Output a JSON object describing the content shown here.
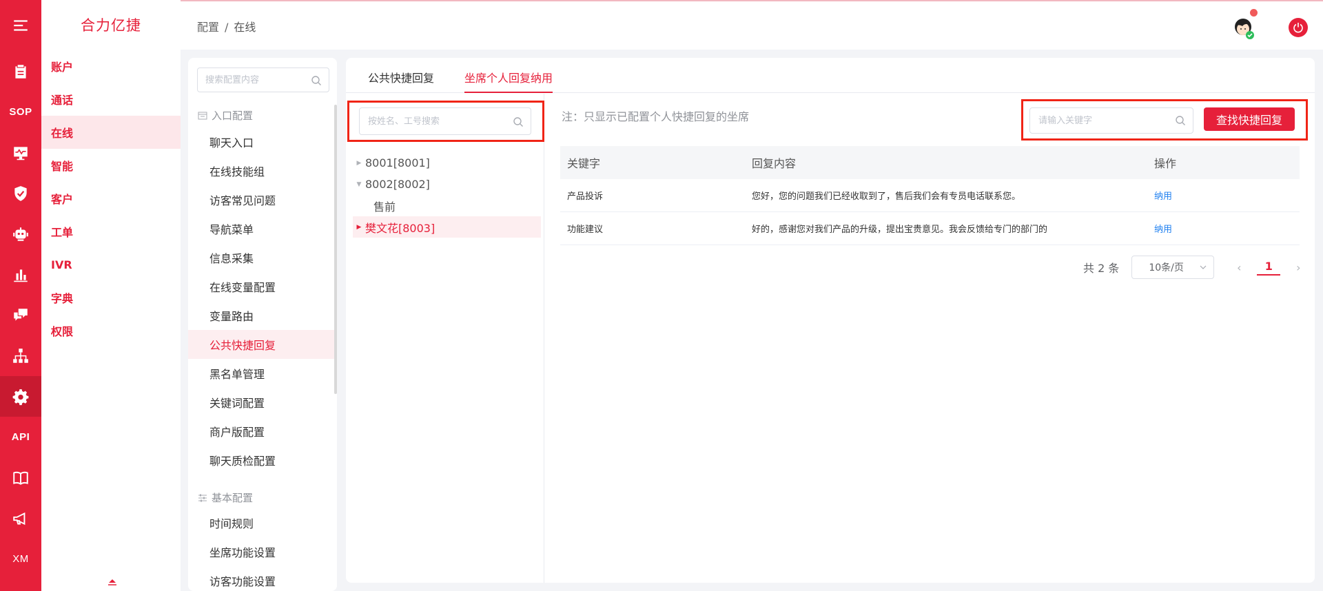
{
  "colors": {
    "brand": "#e6203a",
    "highlight_box": "#f02416",
    "link": "#1e7ff0"
  },
  "rail": {
    "items": [
      {
        "name": "menu-icon"
      },
      {
        "name": "clipboard-icon"
      },
      {
        "name": "sop-text",
        "text": "SOP"
      },
      {
        "name": "monitor-icon"
      },
      {
        "name": "shield-icon"
      },
      {
        "name": "robot-icon"
      },
      {
        "name": "bar-chart-icon"
      },
      {
        "name": "chat-icon"
      },
      {
        "name": "org-chart-icon"
      },
      {
        "name": "gear-icon"
      },
      {
        "name": "api-text",
        "text": "API"
      },
      {
        "name": "book-icon"
      },
      {
        "name": "megaphone-icon"
      },
      {
        "name": "xm-text",
        "text": "XM"
      }
    ],
    "sop_label": "SOP",
    "api_label": "API",
    "xm_label": "XM"
  },
  "module_menu": {
    "brand": "合力亿捷",
    "items": [
      "账户",
      "通话",
      "在线",
      "智能",
      "客户",
      "工单",
      "IVR",
      "字典",
      "权限"
    ],
    "active_index": 2
  },
  "header": {
    "breadcrumb": [
      "配置",
      "在线"
    ],
    "separator": "/"
  },
  "config_menu": {
    "search_placeholder": "搜索配置内容",
    "section1": "入口配置",
    "items1": [
      "聊天入口",
      "在线技能组",
      "访客常见问题",
      "导航菜单",
      "信息采集",
      "在线变量配置",
      "变量路由",
      "公共快捷回复",
      "黑名单管理",
      "关键词配置",
      "商户版配置",
      "聊天质检配置"
    ],
    "active_item": "公共快捷回复",
    "section2": "基本配置",
    "items2": [
      "时间规则",
      "坐席功能设置",
      "访客功能设置"
    ]
  },
  "tabs": [
    "公共快捷回复",
    "坐席个人回复纳用"
  ],
  "active_tab": 1,
  "tree": {
    "search_placeholder": "按姓名、工号搜索",
    "nodes": [
      {
        "label": "8001[8001]",
        "state": "collapsed"
      },
      {
        "label": "8002[8002]",
        "state": "expanded"
      },
      {
        "label": "售前",
        "state": "leaf"
      },
      {
        "label": "樊文花[8003]",
        "state": "selected"
      }
    ]
  },
  "note": "注：只显示已配置个人快捷回复的坐席",
  "keyword_search": {
    "placeholder": "请输入关键字",
    "button": "查找快捷回复"
  },
  "table": {
    "headers": [
      "关键字",
      "回复内容",
      "操作"
    ],
    "rows": [
      {
        "keyword": "产品投诉",
        "content": "您好，您的问题我们已经收取到了，售后我们会有专员电话联系您。",
        "action": "纳用"
      },
      {
        "keyword": "功能建议",
        "content": "好的，感谢您对我们产品的升级，提出宝贵意见。我会反馈给专门的部门的",
        "action": "纳用"
      }
    ]
  },
  "pagination": {
    "total": "共 2 条",
    "page_size": "10条/页",
    "current_page": "1"
  }
}
